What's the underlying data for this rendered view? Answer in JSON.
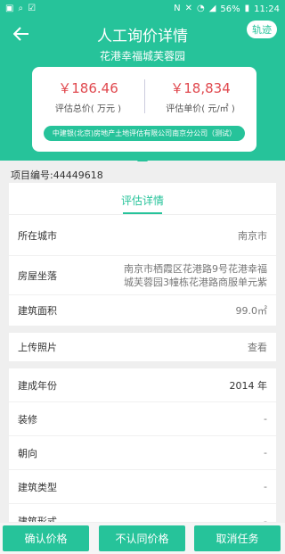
{
  "status_bar": {
    "left_icons": [
      "photo-icon",
      "search-icon",
      "check-icon"
    ],
    "right_icons": [
      "nfc-icon",
      "mute-icon",
      "wifi-icon",
      "signal-icon"
    ],
    "battery": "56%",
    "time": "11:24"
  },
  "header": {
    "title": "人工询价详情",
    "track_label": "轨迹",
    "subtitle": "花港幸福城芙蓉园"
  },
  "price_card": {
    "total_value": "￥186.46",
    "total_caption": "评估总价( 万元 )",
    "unit_value": "￥18,834",
    "unit_caption": "评估单价( 元/㎡ )",
    "company": "中建银(北京)房地产土地评估有限公司南京分公司（测试）"
  },
  "project": {
    "number_label": "项目编号:44449618"
  },
  "tabs": [
    {
      "label": "评估详情"
    }
  ],
  "details": {
    "city_label": "所在城市",
    "city_value": "南京市",
    "address_label": "房屋坐落",
    "address_line1": "南京市栖霞区花港路9号花港幸福",
    "address_line2": "城芙蓉园3幢栋花港路商服单元紫",
    "area_label": "建筑面积",
    "area_value": "99.0㎡",
    "photo_label": "上传照片",
    "photo_value": "查看",
    "year_label": "建成年份",
    "year_value": "2014 年",
    "decoration_label": "装修",
    "decoration_value": "-",
    "orientation_label": "朝向",
    "orientation_value": "-",
    "type_label": "建筑类型",
    "type_value": "-",
    "form_label": "建筑形式",
    "form_value": "-"
  },
  "actions": {
    "confirm": "确认价格",
    "reject": "不认同价格",
    "cancel": "取消任务"
  },
  "colors": {
    "primary": "#26c39a",
    "price": "#e0484e"
  }
}
